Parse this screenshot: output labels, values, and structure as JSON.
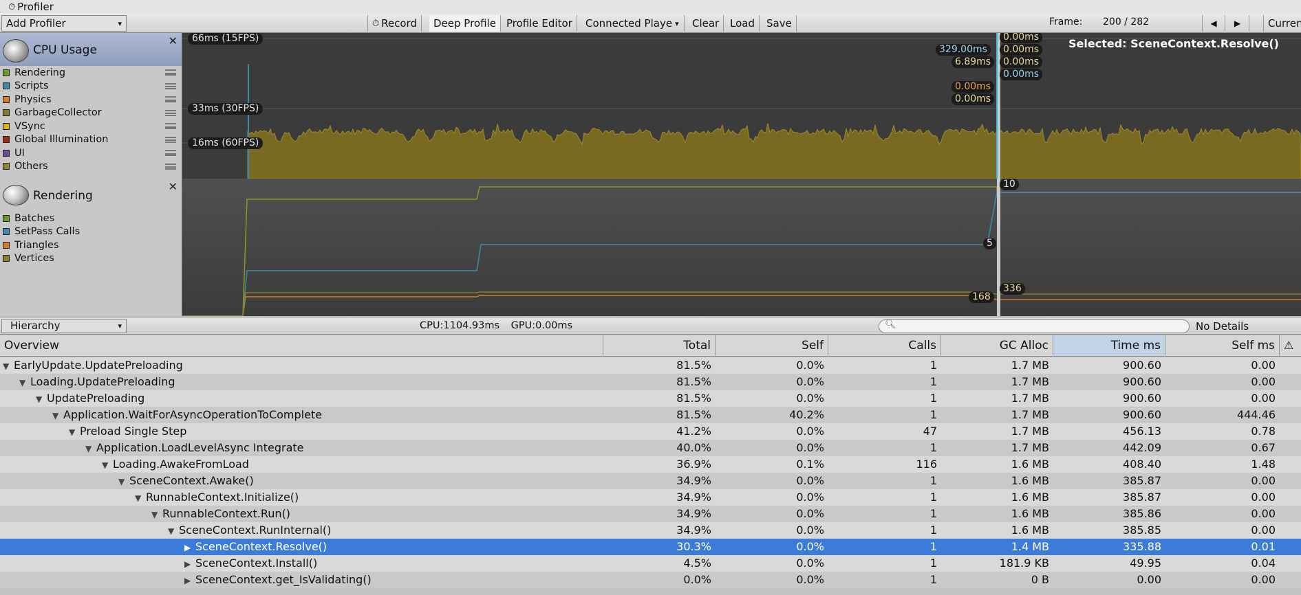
{
  "window": {
    "title": "Profiler"
  },
  "toolbar": {
    "add_profiler": "Add Profiler",
    "record": "Record",
    "deep_profile": "Deep Profile",
    "profile_editor": "Profile Editor",
    "connected_player": "Connected Playe",
    "clear": "Clear",
    "load": "Load",
    "save": "Save",
    "frame_label": "Frame:",
    "frame_value": "200 / 282",
    "prev": "◀",
    "next": "▶",
    "current": "Curren"
  },
  "cpu_panel": {
    "title": "CPU Usage",
    "legend": [
      {
        "label": "Rendering",
        "color": "#6f9a22"
      },
      {
        "label": "Scripts",
        "color": "#3f8aa8"
      },
      {
        "label": "Physics",
        "color": "#d77b1c"
      },
      {
        "label": "GarbageCollector",
        "color": "#8a7a2c"
      },
      {
        "label": "VSync",
        "color": "#d7b21c"
      },
      {
        "label": "Global Illumination",
        "color": "#a02a18"
      },
      {
        "label": "UI",
        "color": "#6a4a98"
      },
      {
        "label": "Others",
        "color": "#8a8a2c"
      }
    ],
    "ms_lines": [
      "66ms (15FPS)",
      "33ms (30FPS)",
      "16ms (60FPS)"
    ],
    "values_left": [
      "329.00ms",
      "6.89ms",
      "0.00ms",
      "0.00ms"
    ],
    "values_right": [
      "0.00ms",
      "0.00ms",
      "0.00ms",
      "0.00ms"
    ],
    "selected": "Selected: SceneContext.Resolve()"
  },
  "rendering_panel": {
    "title": "Rendering",
    "legend": [
      {
        "label": "Batches",
        "color": "#6f9a22"
      },
      {
        "label": "SetPass Calls",
        "color": "#3f8aa8"
      },
      {
        "label": "Triangles",
        "color": "#d77b1c"
      },
      {
        "label": "Vertices",
        "color": "#8a7a2c"
      }
    ],
    "values": [
      "10",
      "5",
      "336",
      "168"
    ]
  },
  "hierarchy_bar": {
    "view": "Hierarchy",
    "cpu": "CPU:1104.93ms",
    "gpu": "GPU:0.00ms",
    "search_placeholder": "",
    "details": "No Details"
  },
  "table": {
    "headers": [
      "Overview",
      "Total",
      "Self",
      "Calls",
      "GC Alloc",
      "Time ms",
      "Self ms"
    ],
    "rows": [
      {
        "depth": 0,
        "name": "EarlyUpdate.UpdatePreloading",
        "expanded": true,
        "total": "81.5%",
        "self": "0.0%",
        "calls": "1",
        "gc": "1.7 MB",
        "time": "900.60",
        "selfms": "0.00"
      },
      {
        "depth": 1,
        "name": "Loading.UpdatePreloading",
        "expanded": true,
        "total": "81.5%",
        "self": "0.0%",
        "calls": "1",
        "gc": "1.7 MB",
        "time": "900.60",
        "selfms": "0.00"
      },
      {
        "depth": 2,
        "name": "UpdatePreloading",
        "expanded": true,
        "total": "81.5%",
        "self": "0.0%",
        "calls": "1",
        "gc": "1.7 MB",
        "time": "900.60",
        "selfms": "0.00"
      },
      {
        "depth": 3,
        "name": "Application.WaitForAsyncOperationToComplete",
        "expanded": true,
        "total": "81.5%",
        "self": "40.2%",
        "calls": "1",
        "gc": "1.7 MB",
        "time": "900.60",
        "selfms": "444.46"
      },
      {
        "depth": 4,
        "name": "Preload Single Step",
        "expanded": true,
        "total": "41.2%",
        "self": "0.0%",
        "calls": "47",
        "gc": "1.7 MB",
        "time": "456.13",
        "selfms": "0.78"
      },
      {
        "depth": 5,
        "name": "Application.LoadLevelAsync Integrate",
        "expanded": true,
        "total": "40.0%",
        "self": "0.0%",
        "calls": "1",
        "gc": "1.7 MB",
        "time": "442.09",
        "selfms": "0.67"
      },
      {
        "depth": 6,
        "name": "Loading.AwakeFromLoad",
        "expanded": true,
        "total": "36.9%",
        "self": "0.1%",
        "calls": "116",
        "gc": "1.6 MB",
        "time": "408.40",
        "selfms": "1.48"
      },
      {
        "depth": 7,
        "name": "SceneContext.Awake()",
        "expanded": true,
        "total": "34.9%",
        "self": "0.0%",
        "calls": "1",
        "gc": "1.6 MB",
        "time": "385.87",
        "selfms": "0.00"
      },
      {
        "depth": 8,
        "name": "RunnableContext.Initialize()",
        "expanded": true,
        "total": "34.9%",
        "self": "0.0%",
        "calls": "1",
        "gc": "1.6 MB",
        "time": "385.87",
        "selfms": "0.00"
      },
      {
        "depth": 9,
        "name": "RunnableContext.Run()",
        "expanded": true,
        "total": "34.9%",
        "self": "0.0%",
        "calls": "1",
        "gc": "1.6 MB",
        "time": "385.86",
        "selfms": "0.00"
      },
      {
        "depth": 10,
        "name": "SceneContext.RunInternal()",
        "expanded": true,
        "total": "34.9%",
        "self": "0.0%",
        "calls": "1",
        "gc": "1.6 MB",
        "time": "385.85",
        "selfms": "0.00"
      },
      {
        "depth": 11,
        "name": "SceneContext.Resolve()",
        "expanded": false,
        "selected": true,
        "total": "30.3%",
        "self": "0.0%",
        "calls": "1",
        "gc": "1.4 MB",
        "time": "335.88",
        "selfms": "0.01"
      },
      {
        "depth": 11,
        "name": "SceneContext.Install()",
        "expanded": false,
        "total": "4.5%",
        "self": "0.0%",
        "calls": "1",
        "gc": "181.9 KB",
        "time": "49.95",
        "selfms": "0.04"
      },
      {
        "depth": 11,
        "name": "SceneContext.get_IsValidating()",
        "expanded": false,
        "total": "0.0%",
        "self": "0.0%",
        "calls": "1",
        "gc": "0 B",
        "time": "0.00",
        "selfms": "0.00"
      }
    ]
  }
}
